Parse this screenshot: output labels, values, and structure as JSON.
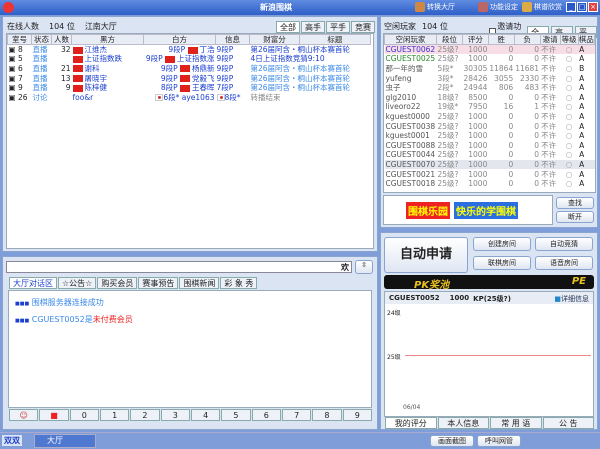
{
  "window": {
    "title": "新浪围棋",
    "toolbar": [
      "转换大厅",
      "功能设定",
      "棋谱欣赏"
    ]
  },
  "hall": {
    "online_label": "在线人数",
    "online_count": "104 位",
    "hall_name": "江南大厅",
    "tabs": [
      "全部",
      "高手",
      "平手",
      "竞赛"
    ],
    "columns": [
      "室号",
      "状态",
      "人数",
      "黑方",
      "白方",
      "信息",
      "财富分",
      "标题"
    ],
    "rows": [
      {
        "room": "8",
        "status": "直播",
        "count": "32",
        "black": "江维杰",
        "brank": "9段P",
        "white": "丁浩",
        "wrank": "9段P",
        "info": "第26届阿含・桐山杯本赛首轮",
        "dark": true
      },
      {
        "room": "5",
        "status": "直播",
        "count": "",
        "black": "上证指数跌",
        "brank": "9段P",
        "white": "上证指数涨",
        "wrank": "9段P",
        "info": "4日上证指数竞猜9:10",
        "dark": true
      },
      {
        "room": "6",
        "status": "直播",
        "count": "21",
        "black": "谢科",
        "brank": "9段P",
        "white": "杨鼎新",
        "wrank": "9段P",
        "info": "第26届阿含・桐山杯本赛首轮",
        "dark": false
      },
      {
        "room": "7",
        "status": "直播",
        "count": "13",
        "black": "屠晓宇",
        "brank": "9段P",
        "white": "党毅飞",
        "wrank": "9段P",
        "info": "第26届阿含・桐山杯本赛首轮",
        "dark": false
      },
      {
        "room": "9",
        "status": "直播",
        "count": "9",
        "black": "陈梓健",
        "brank": "8段P",
        "white": "王春晖",
        "wrank": "7段P",
        "info": "第26届阿含・桐山杯本赛首轮",
        "dark": false
      },
      {
        "room": "26",
        "status": "讨论",
        "count": "",
        "black": "foo&r",
        "brank": "6段*",
        "white": "aye1063",
        "wrank": "8段*",
        "info": "转播结束",
        "korea": true
      }
    ]
  },
  "players": {
    "label": "空闲玩家",
    "count": "104 位",
    "invite_label": "邀请功能",
    "tabs": [
      "全部",
      "高手",
      "平手"
    ],
    "columns": [
      "空闲玩家",
      "段位",
      "评分",
      "胜",
      "负",
      "邀请",
      "等级",
      "棋品"
    ],
    "rows": [
      [
        "CGUEST0062",
        "25级?",
        "1000",
        "0",
        "0",
        "不许",
        "A"
      ],
      [
        "CGUEST0025",
        "25级?",
        "1000",
        "0",
        "0",
        "不许",
        "A"
      ],
      [
        "那一年的雪",
        "5段*",
        "30305",
        "11864",
        "11681",
        "不许",
        "B"
      ],
      [
        "yufeng",
        "3段*",
        "28426",
        "3055",
        "2330",
        "不许",
        "A"
      ],
      [
        "虫子",
        "2段*",
        "24944",
        "806",
        "483",
        "不许",
        "A"
      ],
      [
        "glg2010",
        "18级?",
        "8500",
        "0",
        "0",
        "不许",
        "A"
      ],
      [
        "liveoro22",
        "19级*",
        "7950",
        "16",
        "1",
        "不许",
        "A"
      ],
      [
        "kguest0000",
        "25级?",
        "1000",
        "0",
        "0",
        "不许",
        "A"
      ],
      [
        "CGUEST0038",
        "25级?",
        "1000",
        "0",
        "0",
        "不许",
        "A"
      ],
      [
        "kguest0001",
        "25级?",
        "1000",
        "0",
        "0",
        "不许",
        "A"
      ],
      [
        "CGUEST0088",
        "25级?",
        "1000",
        "0",
        "0",
        "不许",
        "A"
      ],
      [
        "CGUEST0044",
        "25级?",
        "1000",
        "0",
        "0",
        "不许",
        "A"
      ],
      [
        "CGUEST0070",
        "25级?",
        "1000",
        "0",
        "0",
        "不许",
        "A"
      ],
      [
        "CGUEST0021",
        "25级?",
        "1000",
        "0",
        "0",
        "不许",
        "A"
      ],
      [
        "CGUEST0018",
        "25级?",
        "1000",
        "0",
        "0",
        "不许",
        "A"
      ]
    ],
    "banner_text": "围棋乐园",
    "banner_slogan": "快乐的学围棋",
    "search": "查找",
    "disconnect": "断开"
  },
  "actions": {
    "auto_apply": "自动申请",
    "create_room": "创建房间",
    "auto_match": "自动竞猜",
    "link_room": "联棋房间",
    "voice_room": "语音房间",
    "pk_pool": "PK奖池",
    "pk_icon": "PE"
  },
  "rating": {
    "user": "CGUEST0052",
    "score": "1000",
    "kp": "KP(25级?)",
    "details": "详细信息",
    "y_top": "24级",
    "y_mid": "25级",
    "x_label": "06/04",
    "tabs": [
      "我的评分",
      "本人信息",
      "常 用 语",
      "公  告"
    ]
  },
  "chat": {
    "input_value": "欢",
    "tabs": [
      "大厅对话区",
      "☆公告☆",
      "购买会员",
      "赛事预告",
      "围棋新闻",
      "彩 象 秀"
    ],
    "messages": [
      {
        "prefix": "■■■",
        "text": "围棋服务器连接成功"
      },
      {
        "prefix": "■■■",
        "user": "CGUEST0052是",
        "warn": "未付费会员"
      }
    ],
    "keys": [
      "0",
      "1",
      "2",
      "3",
      "4",
      "5",
      "6",
      "7",
      "8",
      "9"
    ]
  },
  "taskbar": {
    "items": [
      "双双",
      "大厅"
    ],
    "right": [
      "画面截图",
      "呼叫网管"
    ]
  }
}
